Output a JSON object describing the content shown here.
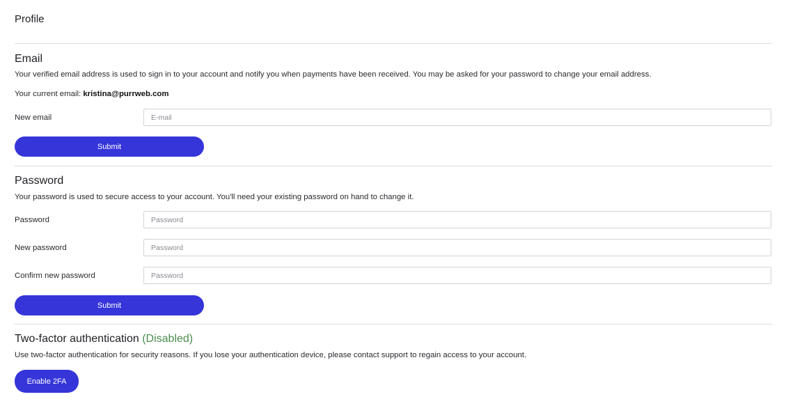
{
  "page": {
    "title": "Profile"
  },
  "email_section": {
    "title": "Email",
    "description": "Your verified email address is used to sign in to your account and notify you when payments have been received. You may be asked for your password to change your email address.",
    "current_label": "Your current email: ",
    "current_value": "kristina@purrweb.com",
    "new_email_label": "New email",
    "new_email_placeholder": "E-mail",
    "new_email_value": "",
    "submit_label": "Submit"
  },
  "password_section": {
    "title": "Password",
    "description": "Your password is used to secure access to your account. You'll need your existing password on hand to change it.",
    "password_label": "Password",
    "password_placeholder": "Password",
    "new_password_label": "New password",
    "new_password_placeholder": "Password",
    "confirm_password_label": "Confirm new password",
    "confirm_password_placeholder": "Password",
    "submit_label": "Submit"
  },
  "twofa_section": {
    "title": "Two-factor authentication",
    "status": "(Disabled)",
    "description": "Use two-factor authentication for security reasons. If you lose your authentication device, please contact support to regain access to your account.",
    "enable_label": "Enable 2FA"
  },
  "colors": {
    "accent": "#3535d9",
    "status_disabled": "#4a8c4d",
    "divider": "#dcdce0"
  }
}
